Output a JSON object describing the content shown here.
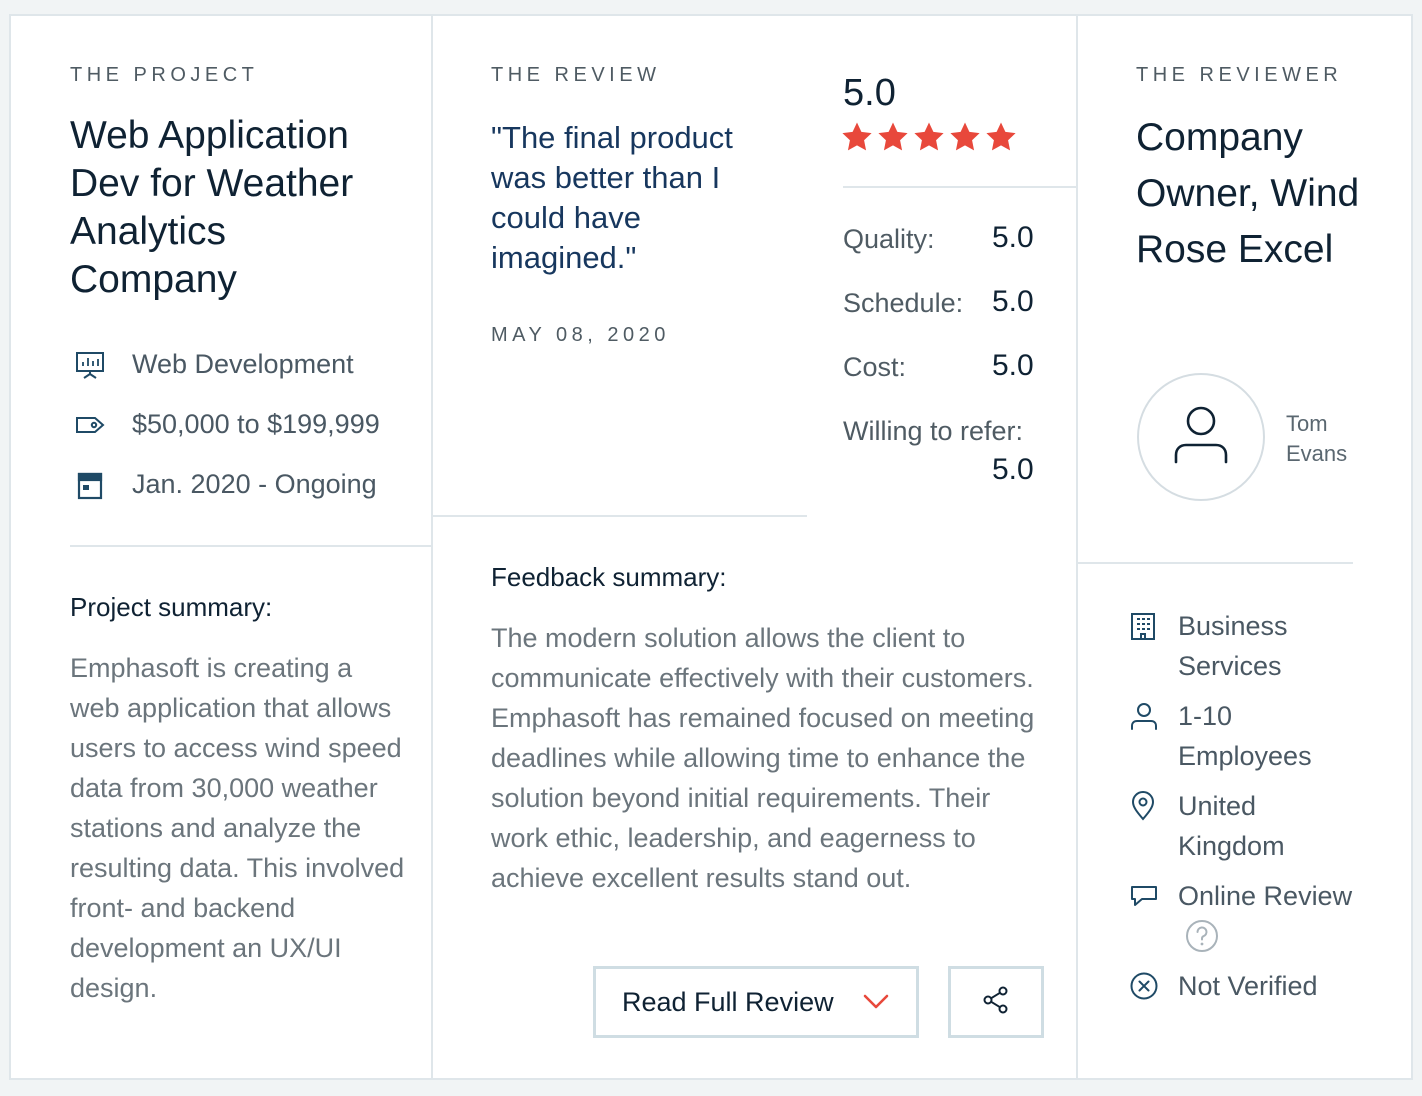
{
  "project": {
    "eyebrow": "THE PROJECT",
    "title": "Web Application Dev for Weather Analytics Company",
    "service": "Web Development",
    "budget": "$50,000 to $199,999",
    "timeline": "Jan. 2020 - Ongoing",
    "summary_heading": "Project summary:",
    "summary": "Emphasoft is creating a web application that allows users to access wind speed data from 30,000 weather stations and analyze the resulting data. This involved front- and backend development an UX/UI design."
  },
  "review": {
    "eyebrow": "THE REVIEW",
    "quote": "\"The final product was better than I could have imagined.\"",
    "date": "MAY 08, 2020",
    "overall": "5.0",
    "stars": 5,
    "ratings": {
      "quality_label": "Quality:",
      "quality": "5.0",
      "schedule_label": "Schedule:",
      "schedule": "5.0",
      "cost_label": "Cost:",
      "cost": "5.0",
      "refer_label": "Willing to refer:",
      "refer": "5.0"
    },
    "feedback_heading": "Feedback summary:",
    "feedback": "The modern solution allows the client to communicate effectively with their customers. Emphasoft has remained focused on meeting deadlines while allowing time to enhance the solution beyond initial requirements. Their work ethic, leadership, and eagerness to achieve excellent results stand out.",
    "read_full_label": "Read Full Review"
  },
  "reviewer": {
    "eyebrow": "THE REVIEWER",
    "title": "Company Owner, Wind Rose Excel",
    "name_first": "Tom",
    "name_last": "Evans",
    "industry": "Business Services",
    "size": "1-10 Employees",
    "location": "United Kingdom",
    "review_type": "Online Review",
    "verification": "Not Verified"
  },
  "colors": {
    "star": "#e8483b",
    "icon": "#1f4a66",
    "chevron": "#e8483b"
  }
}
